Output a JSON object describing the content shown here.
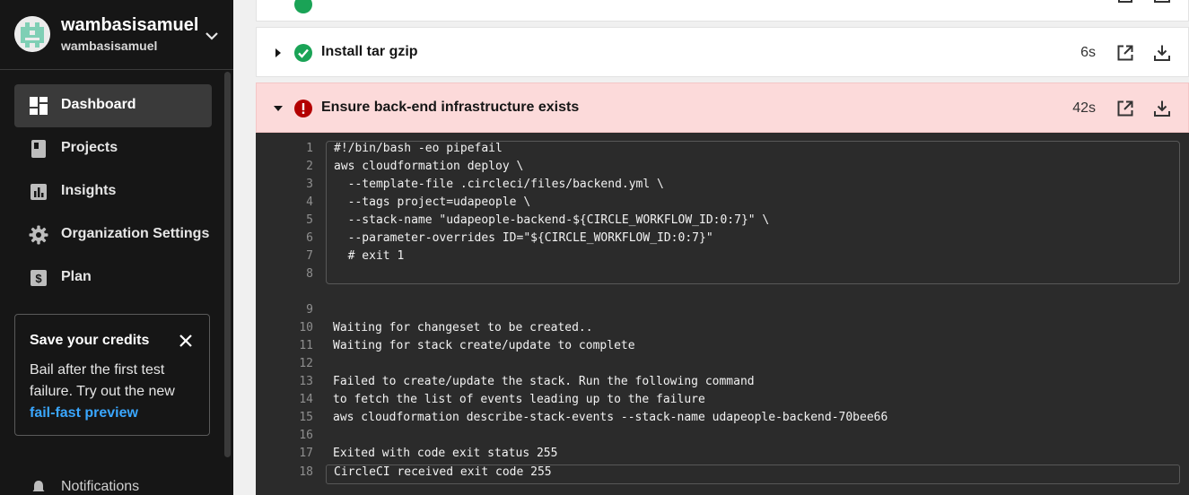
{
  "sidebar": {
    "org_name": "wambasisamuel",
    "org_handle": "wambasisamuel",
    "nav": [
      {
        "label": "Dashboard",
        "icon": "dashboard-icon",
        "active": true
      },
      {
        "label": "Projects",
        "icon": "projects-icon"
      },
      {
        "label": "Insights",
        "icon": "insights-icon"
      },
      {
        "label": "Organization Settings",
        "icon": "gear-icon"
      },
      {
        "label": "Plan",
        "icon": "dollar-icon"
      }
    ],
    "credits": {
      "title": "Save your credits",
      "body": "Bail after the first test failure. Try out the new",
      "link": "fail-fast preview"
    },
    "notifications_label": "Notifications"
  },
  "steps": [
    {
      "title": "Install tar gzip",
      "duration": "6s",
      "status": "success"
    },
    {
      "title": "Ensure back-end infrastructure exists",
      "duration": "42s",
      "status": "failed"
    }
  ],
  "terminal": {
    "lines": [
      {
        "n": "1",
        "text": "#!/bin/bash -eo pipefail"
      },
      {
        "n": "2",
        "text": "aws cloudformation deploy \\"
      },
      {
        "n": "3",
        "text": "  --template-file .circleci/files/backend.yml \\"
      },
      {
        "n": "4",
        "text": "  --tags project=udapeople \\"
      },
      {
        "n": "5",
        "text": "  --stack-name \"udapeople-backend-${CIRCLE_WORKFLOW_ID:0:7}\" \\"
      },
      {
        "n": "6",
        "text": "  --parameter-overrides ID=\"${CIRCLE_WORKFLOW_ID:0:7}\""
      },
      {
        "n": "7",
        "text": "  # exit 1"
      },
      {
        "n": "8",
        "text": ""
      },
      {
        "n": "9",
        "text": ""
      },
      {
        "n": "10",
        "text": "Waiting for changeset to be created.."
      },
      {
        "n": "11",
        "text": "Waiting for stack create/update to complete"
      },
      {
        "n": "12",
        "text": ""
      },
      {
        "n": "13",
        "text": "Failed to create/update the stack. Run the following command"
      },
      {
        "n": "14",
        "text": "to fetch the list of events leading up to the failure"
      },
      {
        "n": "15",
        "text": "aws cloudformation describe-stack-events --stack-name udapeople-backend-70bee66"
      },
      {
        "n": "16",
        "text": ""
      },
      {
        "n": "17",
        "text": "Exited with code exit status 255"
      },
      {
        "n": "18",
        "text": "CircleCI received exit code 255"
      }
    ]
  },
  "colors": {
    "sidebar_bg": "#161616",
    "success": "#1aa356",
    "error": "#b30000",
    "failed_row_bg": "#fcdada",
    "link": "#3aa7ff",
    "terminal_bg": "#2b2b2b"
  }
}
